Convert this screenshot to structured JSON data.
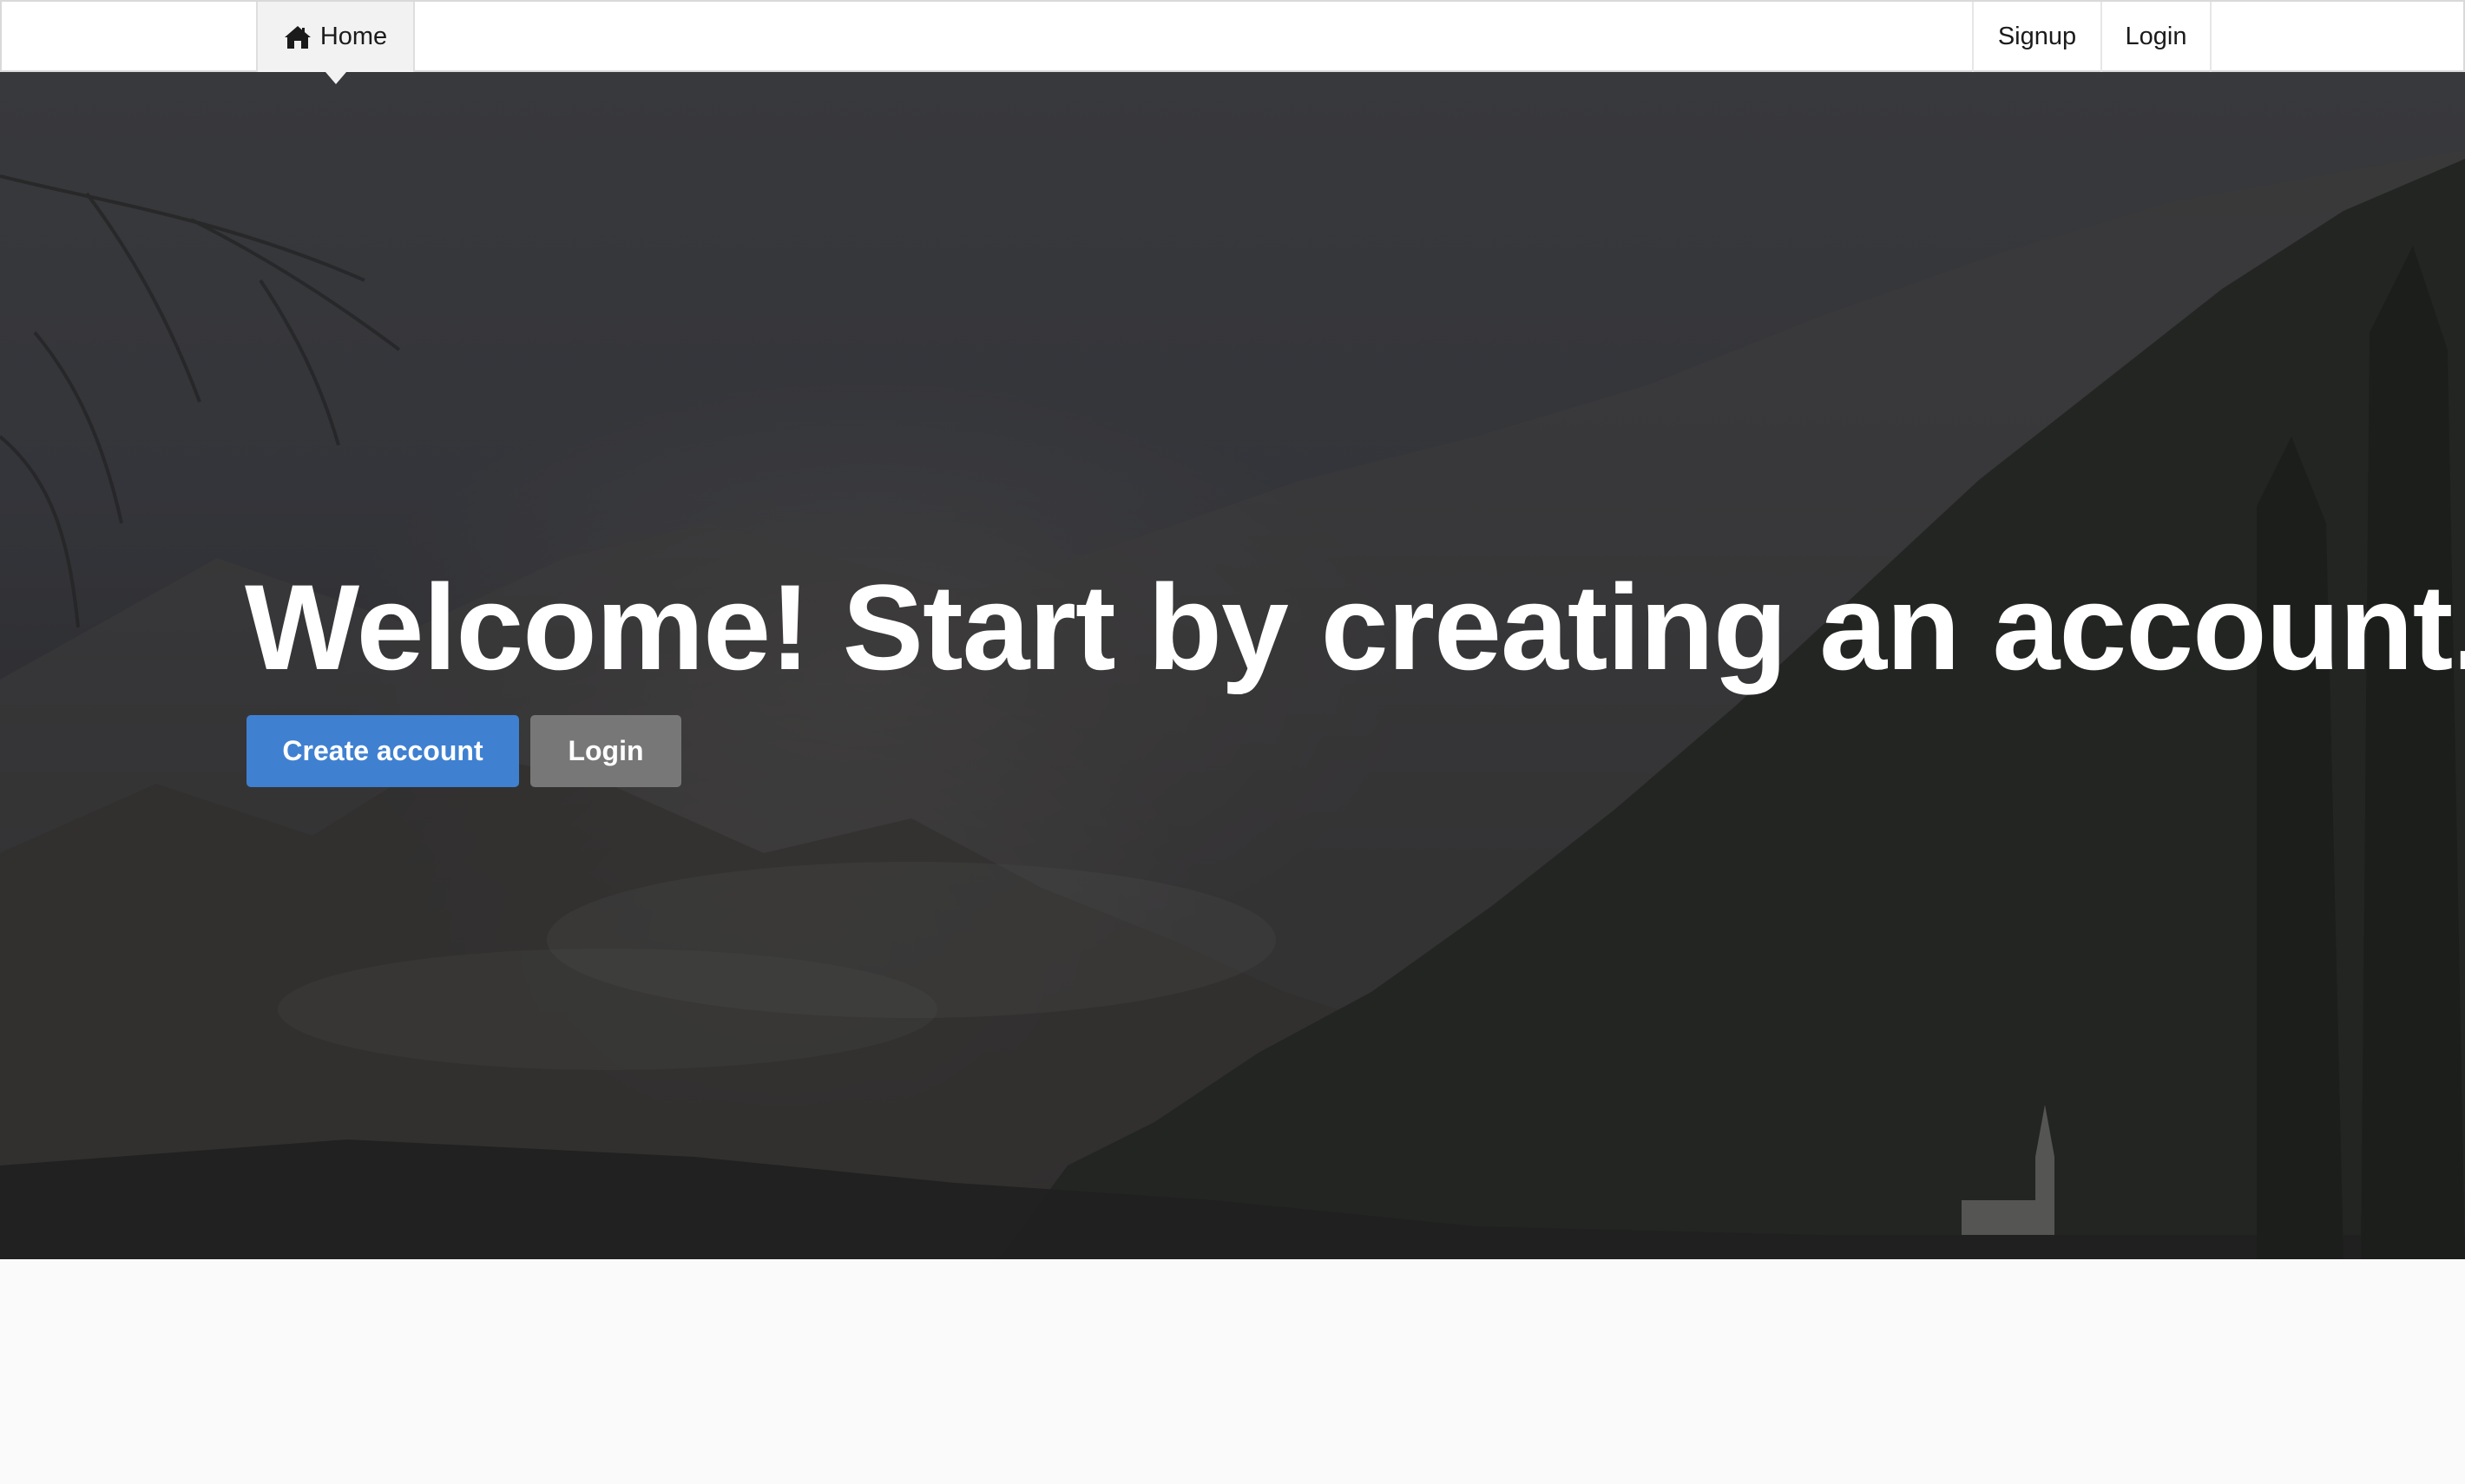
{
  "navbar": {
    "home_label": "Home",
    "home_icon": "home-icon",
    "signup_label": "Signup",
    "login_label": "Login"
  },
  "hero": {
    "title": "Welcome! Start by creating an account.",
    "create_account_label": "Create account",
    "login_label": "Login"
  },
  "colors": {
    "primary": "#3f80d0",
    "secondary": "#777777",
    "navbar_bg": "#ffffff",
    "active_nav_bg": "#f2f2f2",
    "page_bg": "#fafafa"
  }
}
